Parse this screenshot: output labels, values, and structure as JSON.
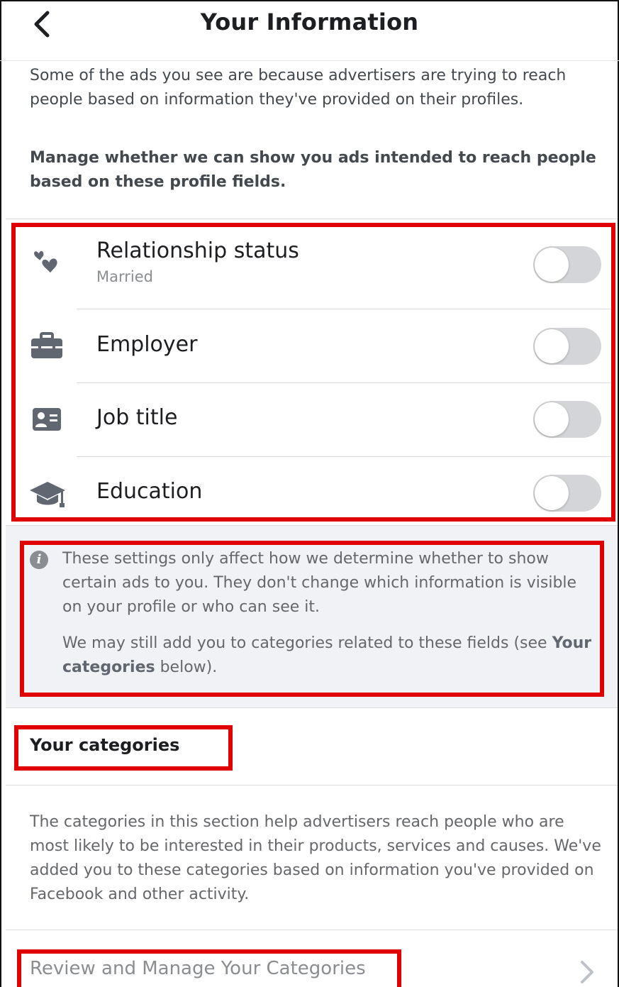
{
  "header": {
    "title": "Your Information"
  },
  "intro": {
    "text": "Some of the ads you see are because advertisers are trying to reach people based on information they've provided on their profiles.",
    "manage_text": "Manage whether we can show you ads intended to reach people based on these profile fields."
  },
  "settings": [
    {
      "label": "Relationship status",
      "value": "Married",
      "icon": "hearts-icon",
      "enabled": false
    },
    {
      "label": "Employer",
      "icon": "briefcase-icon",
      "enabled": false
    },
    {
      "label": "Job title",
      "icon": "id-card-icon",
      "enabled": false
    },
    {
      "label": "Education",
      "icon": "graduation-cap-icon",
      "enabled": false
    }
  ],
  "info": {
    "text": "These settings only affect how we determine whether to show certain ads to you. They don't change which information is visible on your profile or who can see it.",
    "text2_prefix": "We may still add you to categories related to these fields (see ",
    "text2_link": "Your categories",
    "text2_suffix": " below)."
  },
  "categories": {
    "title": "Your categories",
    "description": "The categories in this section help advertisers reach people who are most likely to be interested in their products, services and causes. We've added you to these categories based on information you've provided on Facebook and other activity.",
    "review_label": "Review and Manage Your Categories"
  },
  "colors": {
    "highlight": "#e00000",
    "toggle_off": "#d4d5d8",
    "icon_gray": "#606770"
  }
}
